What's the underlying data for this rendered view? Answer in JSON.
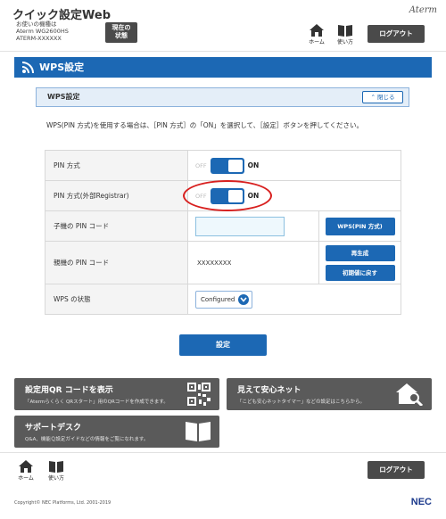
{
  "header": {
    "app_title": "クイック設定Web",
    "device_lines": [
      "お使いの機種は",
      "Aterm WG2600HS",
      "ATERM-XXXXXX"
    ],
    "status_button": [
      "現在の",
      "状態"
    ],
    "brand": "Aterm",
    "home_label": "ホーム",
    "manual_label": "使い方",
    "logout_label": "ログアウト"
  },
  "page": {
    "title": "WPS設定"
  },
  "section": {
    "title": "WPS設定",
    "close_label": "閉じる",
    "description": "WPS(PIN 方式)を使用する場合は、［PIN 方式］の「ON」を選択して、［設定］ボタンを押してください。"
  },
  "table": {
    "rows": [
      {
        "label": "PIN 方式",
        "off": "OFF",
        "on": "ON"
      },
      {
        "label": "PIN 方式(外部Registrar)",
        "off": "OFF",
        "on": "ON"
      },
      {
        "label": "子機の PIN コード",
        "input_value": "",
        "button": "WPS(PIN 方式)"
      },
      {
        "label": "親機の PIN コード",
        "value": "XXXXXXXX",
        "buttons": [
          "再生成",
          "初期値に戻す"
        ]
      },
      {
        "label": "WPS の状態",
        "select_value": "Configured"
      }
    ]
  },
  "submit_label": "設定",
  "cards": [
    {
      "title": "設定用QR コードを表示",
      "subtitle": "「Atermらくらく QRスタート」用のQRコードを作成できます。",
      "icon": "qr-code-icon"
    },
    {
      "title": "見えて安心ネット",
      "subtitle": "「こども安心ネットタイマー」などの設定はこちらから。",
      "icon": "home-search-icon"
    },
    {
      "title": "サポートデスク",
      "subtitle": "Q&A、機能Ｑ設定ガイドなどの情報をご覧になれます。",
      "icon": "book-icon"
    }
  ],
  "footer": {
    "home_label": "ホーム",
    "manual_label": "使い方",
    "logout_label": "ログアウト",
    "copyright": "Copyright© NEC Platforms, Ltd. 2001-2019",
    "logo": "NEC"
  },
  "colors": {
    "primary": "#1c68b4",
    "dark_button": "#4a4a4a",
    "card": "#5a5a5a",
    "highlight": "#d8201f"
  }
}
